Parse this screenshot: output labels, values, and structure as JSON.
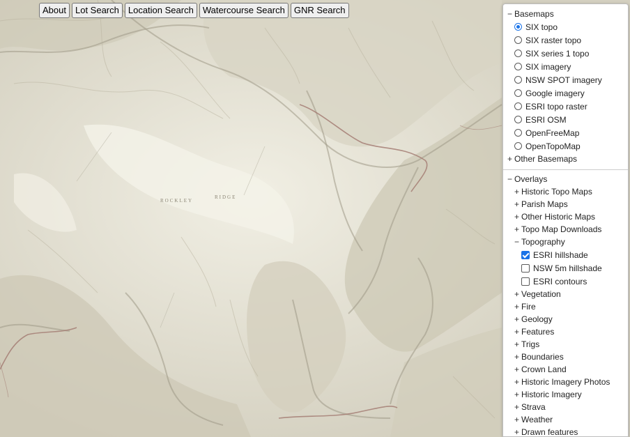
{
  "toolbar": {
    "buttons": [
      "About",
      "Lot Search",
      "Location Search",
      "Watercourse Search",
      "GNR Search"
    ]
  },
  "map": {
    "labels": [
      "ROCKLEY",
      "RIDGE"
    ]
  },
  "layers": {
    "basemaps": {
      "title": "Basemaps",
      "toggle": "−",
      "selected": "SIX topo",
      "items": [
        "SIX topo",
        "SIX raster topo",
        "SIX series 1 topo",
        "SIX imagery",
        "NSW SPOT imagery",
        "Google imagery",
        "ESRI topo raster",
        "ESRI OSM",
        "OpenFreeMap",
        "OpenTopoMap"
      ],
      "other": "Other Basemaps",
      "other_toggle": "+"
    },
    "overlays": {
      "title": "Overlays",
      "toggle": "−",
      "groups_before": [
        "Historic Topo Maps",
        "Parish Maps",
        "Other Historic Maps",
        "Topo Map Downloads"
      ],
      "topography": {
        "title": "Topography",
        "toggle": "−",
        "items": [
          {
            "label": "ESRI hillshade",
            "checked": true
          },
          {
            "label": "NSW 5m hillshade",
            "checked": false
          },
          {
            "label": "ESRI contours",
            "checked": false
          }
        ]
      },
      "groups_after": [
        "Vegetation",
        "Fire",
        "Geology",
        "Features",
        "Trigs",
        "Boundaries",
        "Crown Land",
        "Historic Imagery Photos",
        "Historic Imagery",
        "Strava",
        "Weather",
        "Drawn features"
      ],
      "plus": "+"
    }
  },
  "colors": {
    "accent": "#1a73e8",
    "terrain_light": "#eeebdf",
    "terrain_shade": "#b0aa97",
    "road": "#a47e74"
  }
}
